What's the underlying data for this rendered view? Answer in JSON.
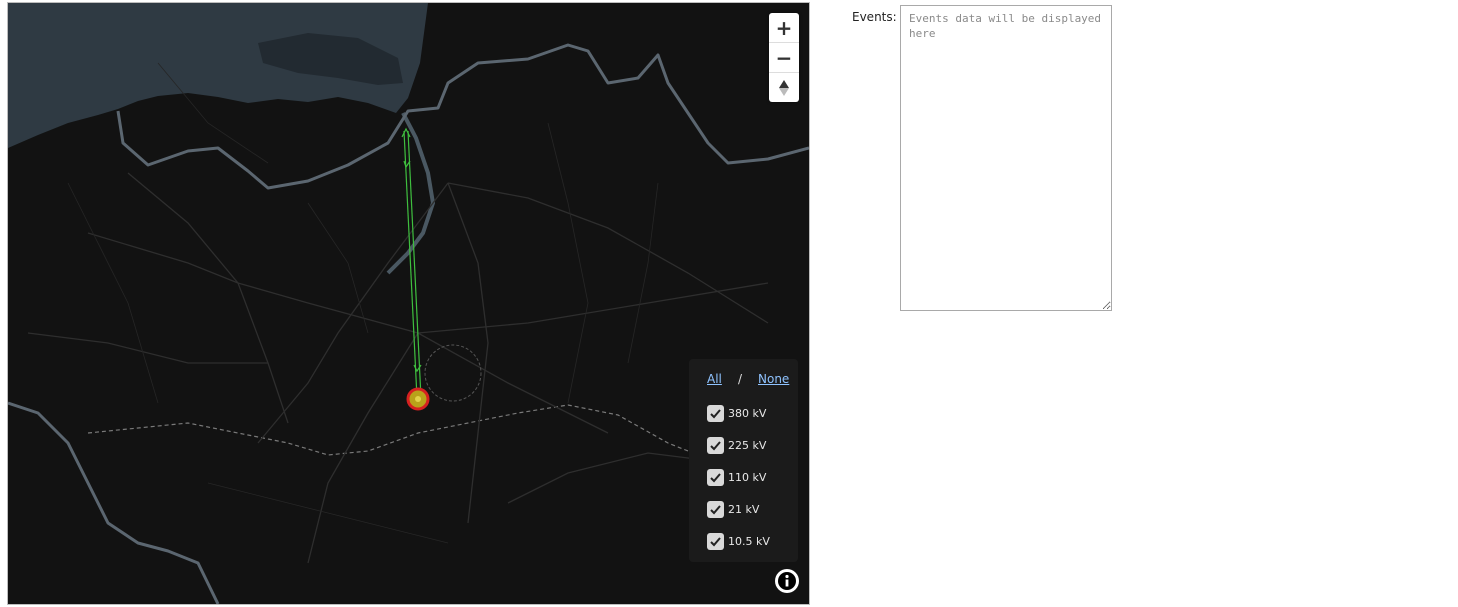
{
  "map": {
    "zoom_in_label": "+",
    "zoom_out_label": "−",
    "compass_label": "▲"
  },
  "layer_filter": {
    "all_label": "All",
    "separator": "/",
    "none_label": "None",
    "layers": [
      {
        "label": "380 kV",
        "checked": true
      },
      {
        "label": "225 kV",
        "checked": true
      },
      {
        "label": "110 kV",
        "checked": true
      },
      {
        "label": "21 kV",
        "checked": true
      },
      {
        "label": "10.5 kV",
        "checked": true
      }
    ]
  },
  "events": {
    "label": "Events:",
    "placeholder": "Events data will be displayed here",
    "value": ""
  },
  "colors": {
    "map_background": "#121212",
    "water": "#2f3a43",
    "border": "#6f7a84",
    "line": "#3fbf3f",
    "substation_ring": "#d62020",
    "substation_fill": "#b9a21a",
    "link": "#8fc3ff"
  }
}
